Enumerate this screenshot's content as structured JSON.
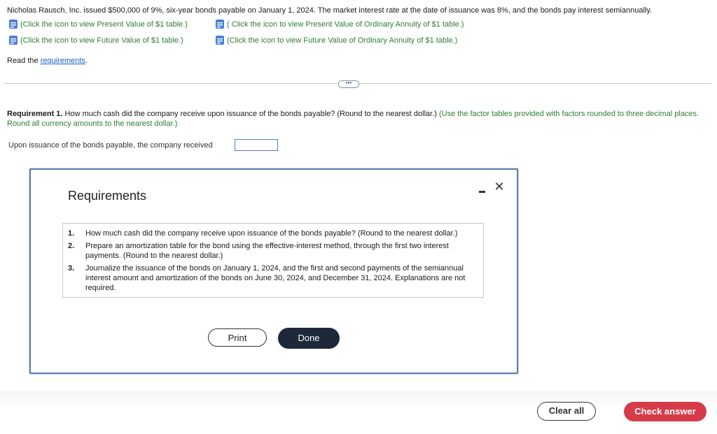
{
  "problem": {
    "intro": "Nicholas Rausch, Inc. issued $500,000 of 9%, six-year bonds payable on January 1, 2024. The market interest rate at the date of issuance was 8%, and the bonds pay interest semiannually."
  },
  "table_links": [
    {
      "label": "(Click the icon to view Present Value of $1 table.)",
      "icon": "document-icon"
    },
    {
      "label": "( Click the icon to view Present Value of Ordinary Annuity of $1 table.)",
      "icon": "document-icon"
    },
    {
      "label": "(Click the icon to view Future Value of $1 table.)",
      "icon": "document-icon"
    },
    {
      "label": "(Click the icon to view Future Value of Ordinary Annuity of $1 table.)",
      "icon": "document-icon"
    }
  ],
  "read_requirements": {
    "prefix": "Read the ",
    "link": "requirements",
    "suffix": "."
  },
  "expand_label": "•••",
  "requirement1": {
    "heading": "Requirement 1.",
    "question": " How much cash did the company receive upon issuance of the bonds payable? (Round to the nearest dollar.) ",
    "note": "(Use the factor tables provided with factors rounded to three decimal places. Round all currency amounts to the nearest dollar.)",
    "answer_label": "Upon issuance of the bonds payable, the company received",
    "answer_value": ""
  },
  "modal": {
    "title": "Requirements",
    "close_glyph": "✕",
    "items": [
      {
        "num": "1.",
        "text": "How much cash did the company receive upon issuance of the bonds payable? (Round to the nearest dollar.)"
      },
      {
        "num": "2.",
        "text": "Prepare an amortization table for the bond using the effective-interest method, through the first two interest payments. (Round to the nearest dollar.)"
      },
      {
        "num": "3.",
        "text": "Journalize the issuance of the bonds on January 1, 2024, and the first and second payments of the semiannual interest amount and amortization of the bonds on June 30, 2024, and December 31, 2024. Explanations are not required."
      }
    ],
    "print_label": "Print",
    "done_label": "Done"
  },
  "footer": {
    "clear_label": "Clear all",
    "check_label": "Check answer"
  },
  "colors": {
    "link_green": "#2e7d32",
    "link_blue": "#1a5dc8",
    "check_red": "#d63b49",
    "done_dark": "#1d2939"
  }
}
